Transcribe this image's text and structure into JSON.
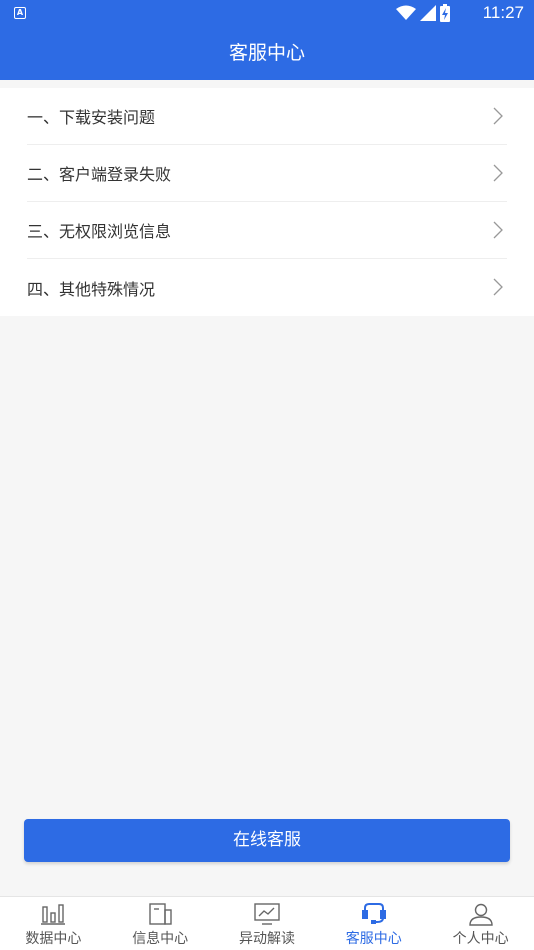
{
  "status_bar": {
    "left_icon": "A",
    "time": "11:27"
  },
  "header": {
    "title": "客服中心"
  },
  "menu": {
    "items": [
      {
        "label": "一、下载安装问题"
      },
      {
        "label": "二、客户端登录失败"
      },
      {
        "label": "三、无权限浏览信息"
      },
      {
        "label": "四、其他特殊情况"
      }
    ]
  },
  "online_service": {
    "label": "在线客服"
  },
  "bottom_nav": {
    "items": [
      {
        "label": "数据中心",
        "icon": "bar-chart-icon"
      },
      {
        "label": "信息中心",
        "icon": "document-icon"
      },
      {
        "label": "异动解读",
        "icon": "monitor-chart-icon"
      },
      {
        "label": "客服中心",
        "icon": "headset-icon"
      },
      {
        "label": "个人中心",
        "icon": "person-icon"
      }
    ],
    "active_index": 3
  },
  "colors": {
    "primary": "#2d6be4",
    "background": "#f6f6f6",
    "text": "#333333"
  }
}
